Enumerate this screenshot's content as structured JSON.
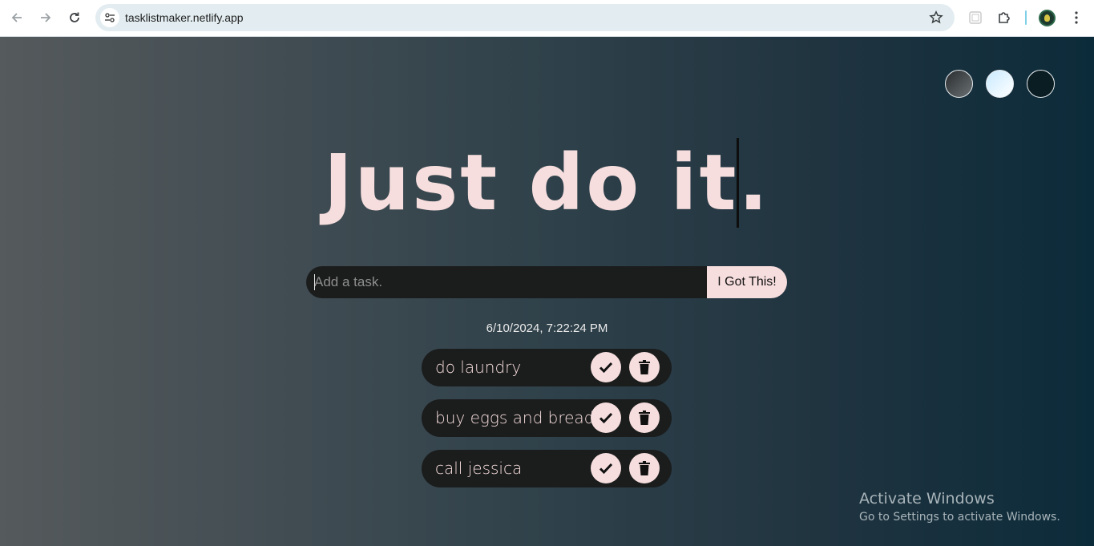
{
  "browser": {
    "url": "tasklistmaker.netlify.app"
  },
  "themes": [
    {
      "name": "standard",
      "color": "#555a5c"
    },
    {
      "name": "light",
      "color": "#dff1ff"
    },
    {
      "name": "darker",
      "color": "#0a1d22"
    }
  ],
  "header": {
    "title": "Just do it."
  },
  "form": {
    "placeholder": "Add a task.",
    "value": "",
    "submit_label": "I Got This!"
  },
  "datetime": "6/10/2024, 7:22:24 PM",
  "todos": [
    {
      "text": "do laundry"
    },
    {
      "text": "buy eggs and bread"
    },
    {
      "text": "call jessica"
    }
  ],
  "watermark": {
    "title": "Activate Windows",
    "subtitle": "Go to Settings to activate Windows."
  },
  "colors": {
    "accent": "#f7dede",
    "surface": "#1b1c1c"
  }
}
